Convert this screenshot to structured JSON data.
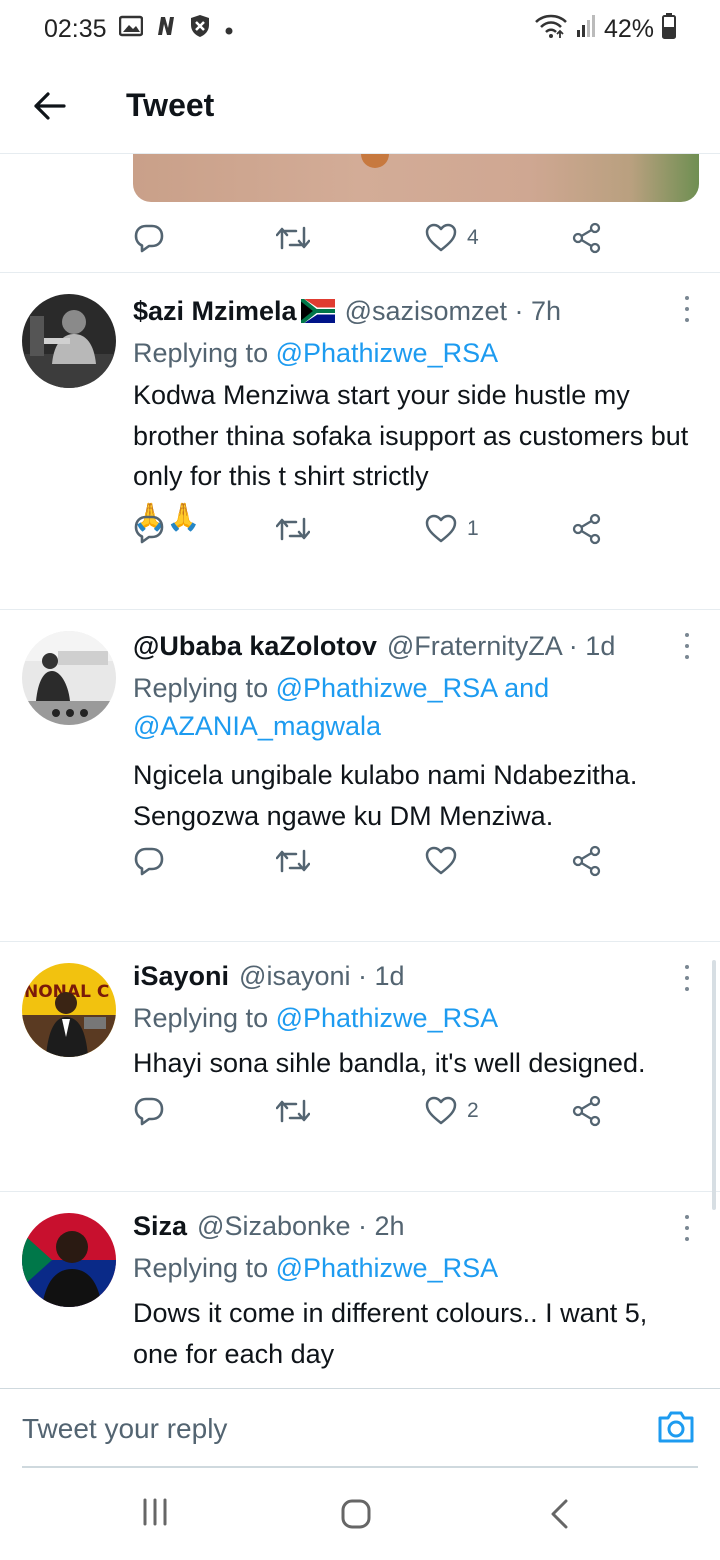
{
  "status_bar": {
    "time": "02:35",
    "left_icons": [
      "gallery-icon",
      "netflix-icon",
      "shield-icon",
      "dot-icon"
    ],
    "right_icons": [
      "wifi-icon",
      "signal-icon"
    ],
    "battery": "42%"
  },
  "header": {
    "title": "Tweet"
  },
  "colors": {
    "link": "#1d9bf0",
    "muted": "#536471",
    "text": "#0f1419",
    "divider": "#e6ecf0"
  },
  "top_tweet": {
    "likes": "4",
    "retweets": "",
    "replies": ""
  },
  "tweets": [
    {
      "name": "$azi Mzimela",
      "flag": "🇿🇦",
      "meta": "@sazisomzet · 7h",
      "reply_prefix": "Replying to ",
      "reply_mentions": "@Phathizwe_RSA",
      "reply_tail": "",
      "text": "Kodwa Menziwa start your side hustle my brother thina sofaka isupport as customers but only for this t shirt strictly",
      "emoji": "🙏🙏",
      "likes": "1"
    },
    {
      "name": "@Ubaba kaZolotov",
      "flag": "",
      "meta": "@FraternityZA · 1d",
      "reply_prefix": "Replying to ",
      "reply_mentions": "@Phathizwe_RSA and @AZANIA_magwala",
      "reply_tail": "",
      "text": "Ngicela ungibale kulabo nami Ndabezitha. Sengozwa ngawe ku DM Menziwa.",
      "emoji": "",
      "likes": ""
    },
    {
      "name": "iSayoni",
      "flag": "",
      "meta": "@isayoni · 1d",
      "reply_prefix": "Replying to ",
      "reply_mentions": "@Phathizwe_RSA",
      "reply_tail": "",
      "text": "Hhayi sona sihle bandla, it's well designed.",
      "emoji": "",
      "likes": "2"
    },
    {
      "name": "Siza",
      "flag": "",
      "meta": "@Sizabonke · 2h",
      "reply_prefix": "Replying to ",
      "reply_mentions": "@Phathizwe_RSA",
      "reply_tail": "",
      "text": "Dows it come in different colours.. I want 5, one for each day",
      "emoji": "",
      "likes": ""
    }
  ],
  "composer": {
    "placeholder": "Tweet your reply"
  },
  "nav": {
    "buttons": [
      "recents-icon",
      "home-icon",
      "back-icon"
    ]
  }
}
